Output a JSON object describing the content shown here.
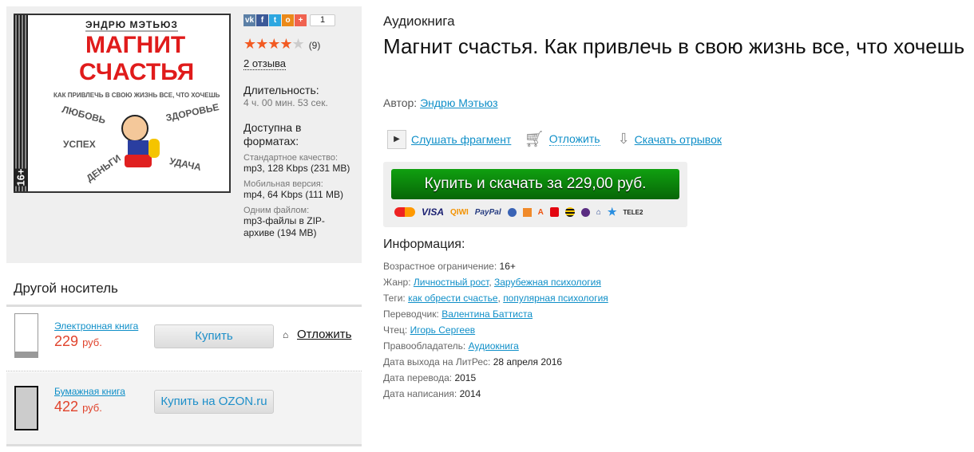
{
  "cover": {
    "author": "ЭНДРЮ МЭТЬЮЗ",
    "title1": "МАГНИТ",
    "title2": "СЧАСТЬЯ",
    "subtitle": "КАК ПРИВЛЕЧЬ В СВОЮ ЖИЗНЬ ВСЕ, ЧТО ХОЧЕШЬ",
    "words": [
      "ЛЮБОВЬ",
      "ЗДОРОВЬЕ",
      "УСПЕХ",
      "ДЕНЬГИ",
      "УДАЧА"
    ],
    "age": "16+"
  },
  "social": {
    "count": "1"
  },
  "rating": {
    "stars": 4,
    "max": 5,
    "count": "(9)",
    "reviews": "2 отзыва"
  },
  "duration": {
    "label": "Длительность:",
    "value": "4 ч. 00 мин. 53 сек."
  },
  "formats": {
    "label": "Доступна в форматах:",
    "items": [
      {
        "label": "Стандартное качество:",
        "value": "mp3, 128 Kbps (231 MB)"
      },
      {
        "label": "Мобильная версия:",
        "value": "mp4, 64 Kbps (111 MB)"
      },
      {
        "label": "Одним файлом:",
        "value": "mp3-файлы в ZIP-архиве (194 MB)"
      }
    ]
  },
  "other": {
    "title": "Другой носитель",
    "items": [
      {
        "format": "Электронная книга",
        "price": "229",
        "currency": "руб.",
        "button": "Купить",
        "defer": "Отложить"
      },
      {
        "format": "Бумажная книга",
        "price": "422",
        "currency": "руб.",
        "button": "Купить на OZON.ru"
      }
    ]
  },
  "book": {
    "type": "Аудиокнига",
    "title": "Магнит счастья. Как привлечь в свою жизнь все, что хочешь",
    "author_label": "Автор:",
    "author": "Эндрю Мэтьюз"
  },
  "actions": {
    "listen": "Слушать фрагмент",
    "defer": "Отложить",
    "download": "Скачать отрывок"
  },
  "buy": {
    "label": "Купить и скачать за 229,00 руб.",
    "payments": [
      "VISA",
      "QIWI",
      "PayPal",
      "TELE2"
    ]
  },
  "info": {
    "title": "Информация:",
    "age_label": "Возрастное ограничение:",
    "age": "16+",
    "genre_label": "Жанр:",
    "genres": [
      "Личностный рост",
      "Зарубежная психология"
    ],
    "tags_label": "Теги:",
    "tags": [
      "как обрести счастье",
      "популярная психология"
    ],
    "translator_label": "Переводчик:",
    "translator": "Валентина Баттиста",
    "reader_label": "Чтец:",
    "reader": "Игорь Сергеев",
    "holder_label": "Правообладатель:",
    "holder": "Аудиокнига",
    "release_label": "Дата выхода на ЛитРес:",
    "release": "28 апреля 2016",
    "translation_label": "Дата перевода:",
    "translation": "2015",
    "written_label": "Дата написания:",
    "written": "2014"
  }
}
